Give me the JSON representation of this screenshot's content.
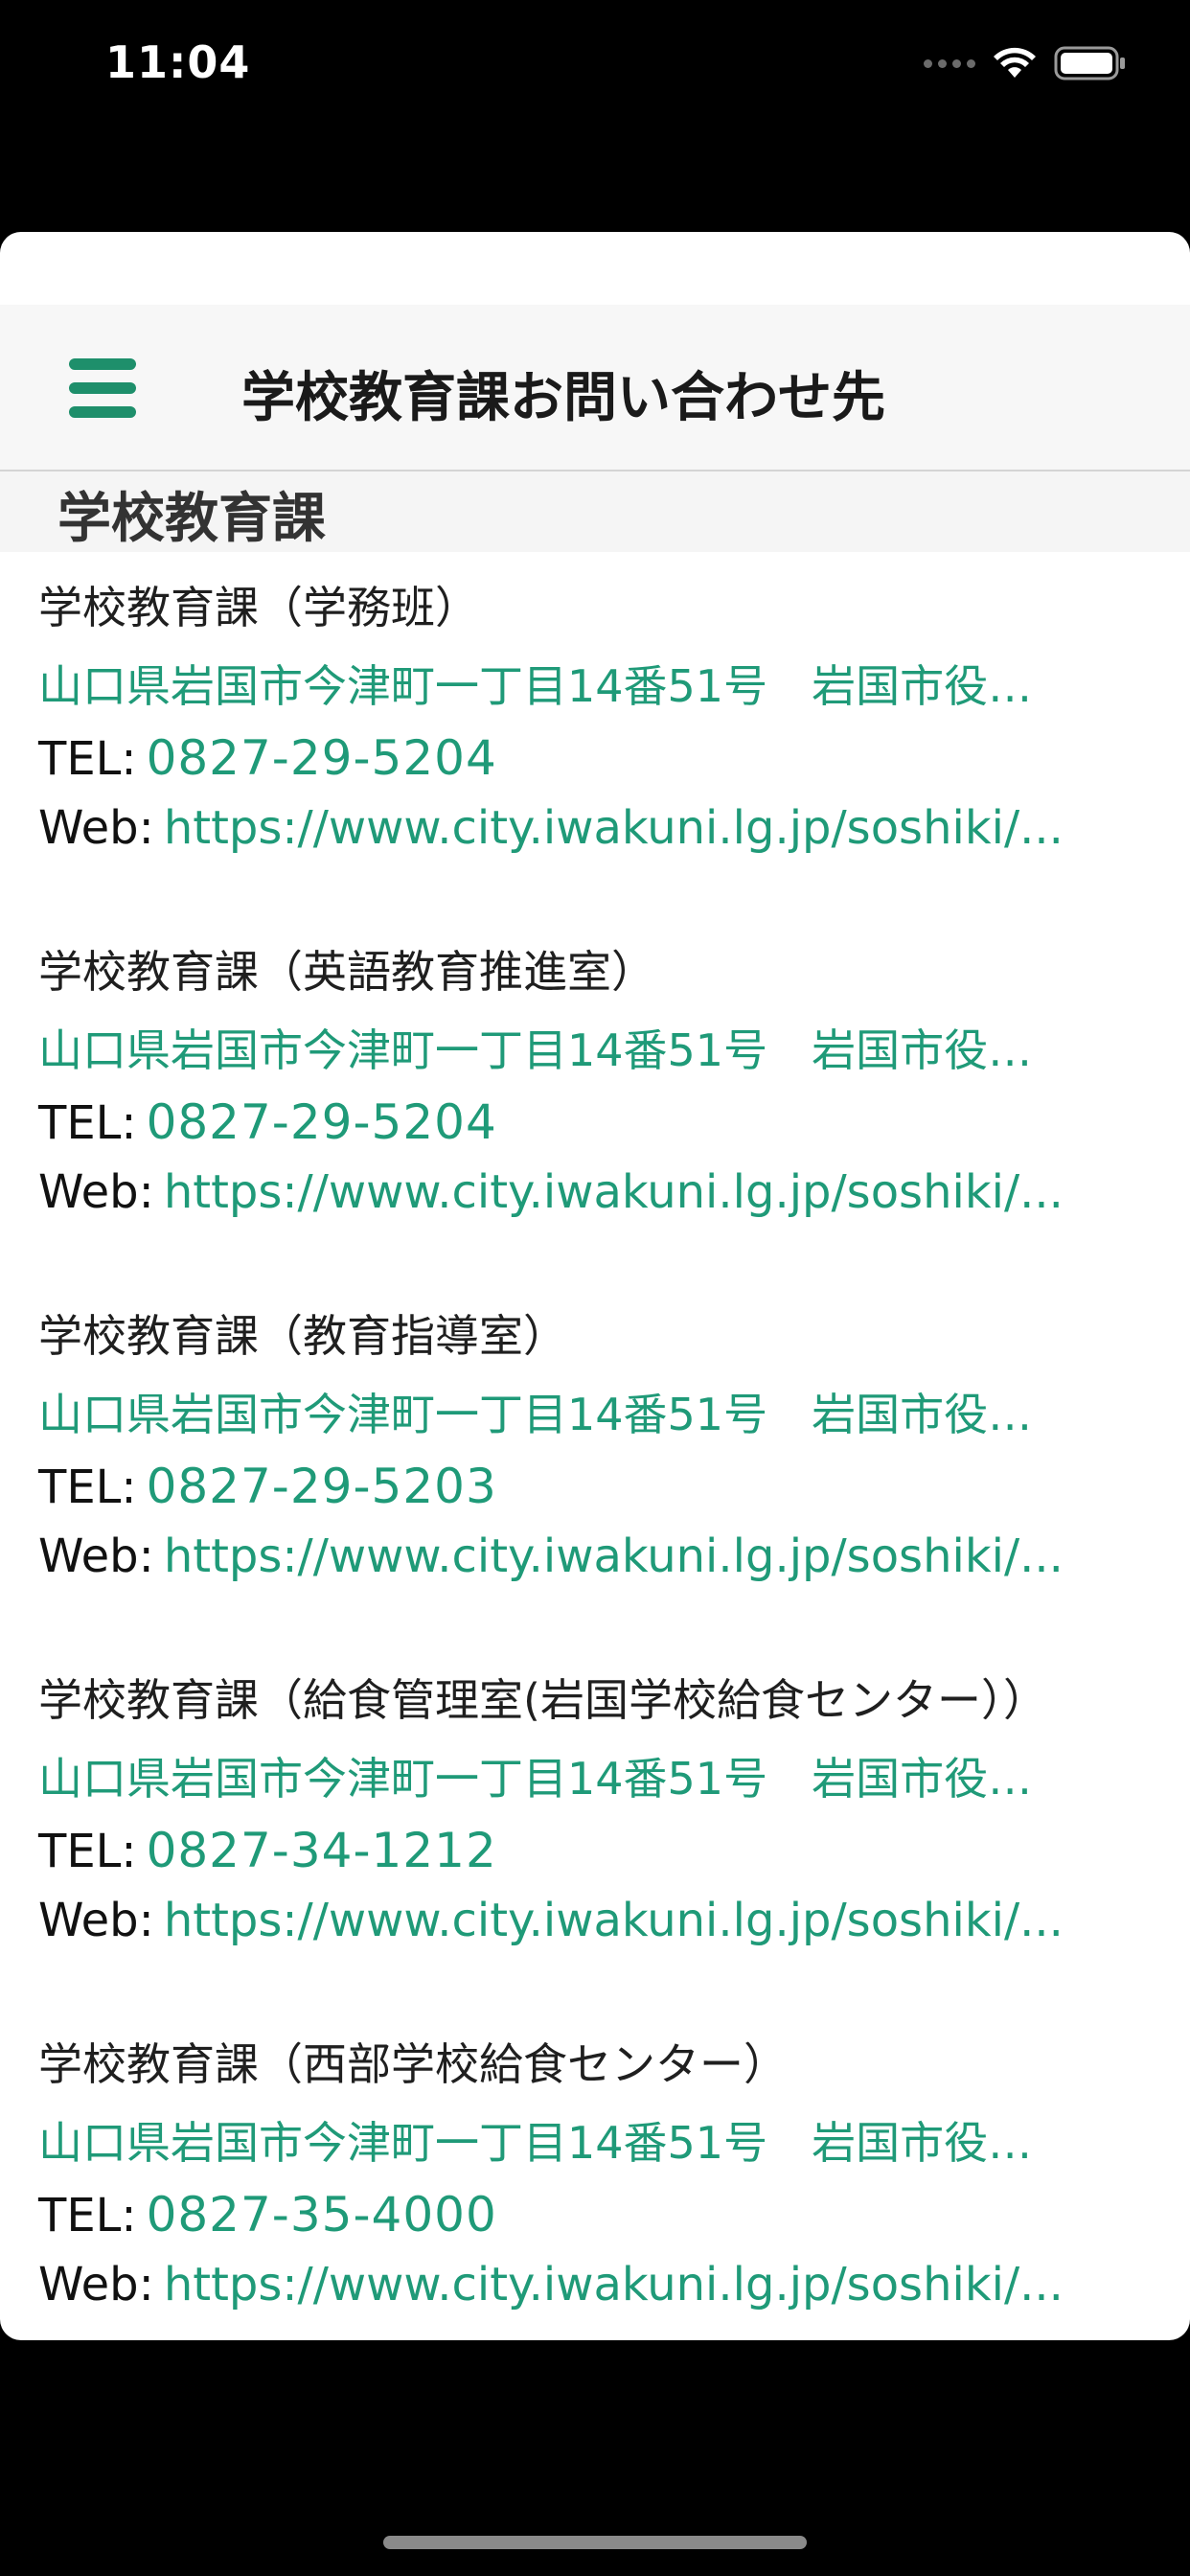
{
  "status_bar": {
    "time": "11:04"
  },
  "header": {
    "title": "学校教育課お問い合わせ先",
    "menu_icon": "hamburger-menu-icon",
    "accent_color": "#1e8f6b"
  },
  "section": {
    "title": "学校教育課"
  },
  "labels": {
    "tel": "TEL:",
    "web": "Web:"
  },
  "entries": [
    {
      "name": "学校教育課（学務班）",
      "address": "山口県岩国市今津町一丁目14番51号　岩国市役…",
      "tel": "0827-29-5204",
      "web": "https://www.city.iwakuni.lg.jp/soshiki/..."
    },
    {
      "name": "学校教育課（英語教育推進室）",
      "address": "山口県岩国市今津町一丁目14番51号　岩国市役…",
      "tel": "0827-29-5204",
      "web": "https://www.city.iwakuni.lg.jp/soshiki/..."
    },
    {
      "name": "学校教育課（教育指導室）",
      "address": "山口県岩国市今津町一丁目14番51号　岩国市役…",
      "tel": "0827-29-5203",
      "web": "https://www.city.iwakuni.lg.jp/soshiki/..."
    },
    {
      "name": "学校教育課（給食管理室(岩国学校給食センター））",
      "address": "山口県岩国市今津町一丁目14番51号　岩国市役…",
      "tel": "0827-34-1212",
      "web": "https://www.city.iwakuni.lg.jp/soshiki/..."
    },
    {
      "name": "学校教育課（西部学校給食センター）",
      "address": "山口県岩国市今津町一丁目14番51号　岩国市役…",
      "tel": "0827-35-4000",
      "web": "https://www.city.iwakuni.lg.jp/soshiki/..."
    }
  ],
  "colors": {
    "link": "#1f9a78",
    "text": "#1f1f1f",
    "nav_background": "#f7f7f7"
  }
}
